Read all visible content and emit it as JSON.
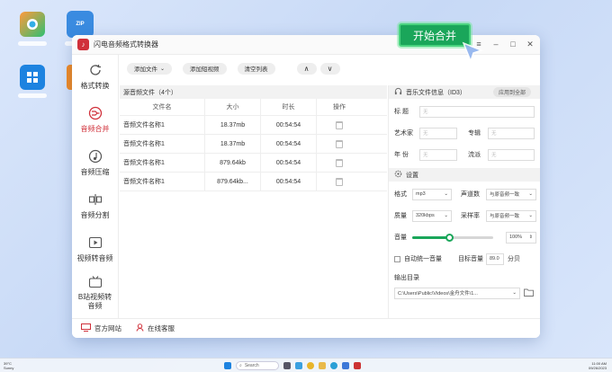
{
  "window": {
    "title": "闪电音频格式转换器",
    "controls": [
      "≡",
      "–",
      "□",
      "✕"
    ]
  },
  "sidebar": {
    "items": [
      {
        "label": "格式转换",
        "icon": "refresh-icon",
        "active": false
      },
      {
        "label": "音频合并",
        "icon": "merge-icon",
        "active": true
      },
      {
        "label": "音频压缩",
        "icon": "music-note-icon",
        "active": false
      },
      {
        "label": "音频分割",
        "icon": "split-icon",
        "active": false
      },
      {
        "label": "视频转音频",
        "icon": "video-play-icon",
        "active": false
      },
      {
        "label": "B站视频转音频",
        "icon": "bilibili-tv-icon",
        "active": false
      }
    ]
  },
  "toolbar": {
    "add_file": "添加文件",
    "add_folder": "添加目录",
    "add_clip": "添加短视频",
    "clear": "清空列表",
    "up": "∧",
    "down": "∨",
    "start": "开始合并"
  },
  "file_list": {
    "header": "源音频文件（4个）",
    "columns": [
      "文件名",
      "大小",
      "时长",
      "操作"
    ],
    "rows": [
      {
        "name": "音频文件名称1",
        "size": "18.37mb",
        "duration": "00:54:54"
      },
      {
        "name": "音频文件名称1",
        "size": "18.37mb",
        "duration": "00:54:54"
      },
      {
        "name": "音频文件名称1",
        "size": "879.64kb",
        "duration": "00:54:54"
      },
      {
        "name": "音频文件名称1",
        "size": "879.64kb...",
        "duration": "00:54:54"
      }
    ]
  },
  "id3": {
    "header": "音乐文件信息（ID3）",
    "apply_all": "应用到全部",
    "title_label": "标   题",
    "artist_label": "艺术家",
    "album_label": "专辑",
    "year_label": "年   份",
    "genre_label": "流派",
    "placeholder": "无"
  },
  "settings": {
    "header": "设置",
    "format_label": "格式",
    "format_value": "mp3",
    "channel_label": "声道数",
    "channel_value": "与原音频一致",
    "quality_label": "质量",
    "quality_value": "320kbps",
    "samplerate_label": "采样率",
    "samplerate_value": "与原音频一致",
    "volume_label": "音量",
    "volume_value": "100%",
    "volume_level": 0.45,
    "normalize_label": "自动统一音量",
    "target_label": "目标音量",
    "target_value": "89.0",
    "target_unit": "分贝",
    "output_label": "输出目录",
    "output_path": "C:\\Users\\Public\\Videos\\金舟文件\\1..."
  },
  "bottom": {
    "website": "官方网站",
    "support": "在线客服"
  },
  "taskbar": {
    "weather_temp": "39°C",
    "weather_desc": "Sunny",
    "search": "Search",
    "time": "11:00 AM",
    "date": "09/26/2023"
  },
  "colors": {
    "accent": "#d0303a",
    "start": "#1aa65a"
  }
}
